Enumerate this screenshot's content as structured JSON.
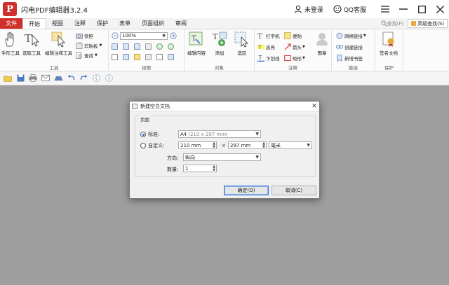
{
  "app": {
    "title": "闪电PDF编辑器3.2.4",
    "logo_letter": "P"
  },
  "window": {
    "user_label": "未登录",
    "qq_label": "QQ客服",
    "menu_icon": "hamburger-icon",
    "min_icon": "minimize-icon",
    "max_icon": "maximize-icon",
    "close_icon": "close-icon"
  },
  "menu": {
    "file": "文件",
    "tabs": [
      "开始",
      "视图",
      "注释",
      "保护",
      "表单",
      "页面组织",
      "审阅"
    ],
    "find": "查找(F)",
    "advanced_find": "高级查找(S)"
  },
  "ribbon": {
    "tools_group": {
      "label": "工具",
      "hand": "手形工具",
      "select": "选取工具",
      "edit_annot": "编辑注释工具",
      "snapshot": "快照",
      "clipboard": "剪贴板",
      "find": "查找"
    },
    "view_group": {
      "label": "视图",
      "zoom": "100%"
    },
    "object_group": {
      "label": "对象",
      "edit_content": "编辑内容",
      "add": "添加",
      "select_area": "选区"
    },
    "annot_group": {
      "label": "注释",
      "typewriter": "打字机",
      "note": "便贴",
      "highlight": "高亮",
      "arrow": "箭头",
      "underline": "下划线",
      "rect": "矩形",
      "stamp": "图章"
    },
    "link_group": {
      "label": "链接",
      "web_link": "网络链接",
      "create_link": "创建链接",
      "new_bookmark": "新增书签"
    },
    "protect_group": {
      "label": "保护",
      "sign": "签名文档"
    }
  },
  "dialog": {
    "title": "新建空白文档",
    "section": "页面",
    "standard_label": "标准:",
    "standard_value": "A4",
    "standard_dims": "(210 x 297 mm)",
    "custom_label": "自定义:",
    "width": "210 mm",
    "times": "×",
    "height": "297 mm",
    "unit": "毫米",
    "orientation_label": "方向:",
    "orientation_value": "纵向",
    "count_label": "数量:",
    "count_value": "1",
    "ok": "确定(O)",
    "cancel": "取消(C)"
  },
  "colors": {
    "accent": "#d0302c",
    "workspace": "#9e9e9e",
    "link_blue": "#3b7bd6"
  }
}
